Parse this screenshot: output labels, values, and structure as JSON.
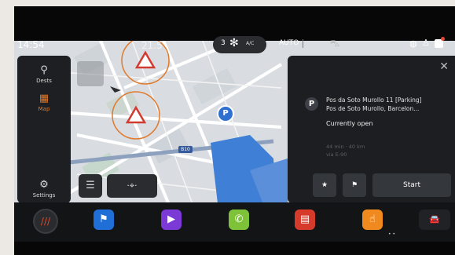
{
  "status": {
    "time": "14:54",
    "temperature": "21.5",
    "fan_level": "3",
    "ac_label": "A/C",
    "auto_label": "AUTO"
  },
  "nav": {
    "items": [
      {
        "label": "Dests",
        "icon": "search-pin-icon"
      },
      {
        "label": "Map",
        "icon": "map-icon"
      },
      {
        "label": "Settings",
        "icon": "gear-icon"
      }
    ]
  },
  "map": {
    "road_label": "B10",
    "poi_letter": "P"
  },
  "panel": {
    "poi_letter": "P",
    "name_line1": "Pos da Soto Murollo 11 [Parking]",
    "name_line2": "Pos de Soto Murollo, Barcelon...",
    "status": "Currently open",
    "meta_line1": "44 min · 40 km",
    "meta_line2": "via E-90",
    "start_label": "Start"
  },
  "colors": {
    "accent": "#e07a2c",
    "panel_bg": "#1c1e21",
    "map_bg": "#d9dde1",
    "water": "#3f7fd6"
  }
}
